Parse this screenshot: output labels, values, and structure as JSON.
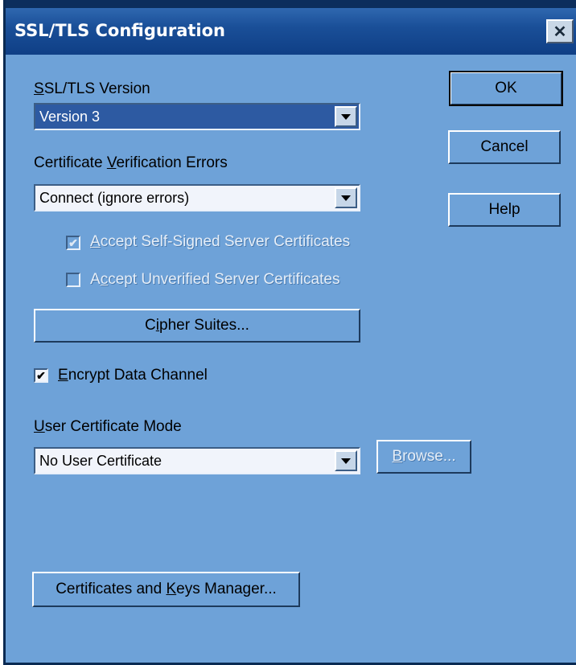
{
  "window": {
    "title": "SSL/TLS Configuration",
    "close_glyph": "✕"
  },
  "ssl_version": {
    "label_key": "S",
    "label_rest": "SL/TLS Version",
    "value": "Version 3"
  },
  "cert_errors": {
    "label_pre": "Certificate ",
    "label_key": "V",
    "label_rest": "erification Errors",
    "value": "Connect (ignore errors)"
  },
  "self_signed": {
    "checked": true,
    "label_key": "A",
    "label_rest": "ccept Self-Signed Server Certificates"
  },
  "unverified": {
    "checked": false,
    "label_pre": "A",
    "label_key": "c",
    "label_rest": "cept Unverified Server Certificates"
  },
  "cipher_button": {
    "label_pre": "C",
    "label_key": "i",
    "label_rest": "pher Suites..."
  },
  "encrypt": {
    "checked": true,
    "label_key": "E",
    "label_rest": "ncrypt Data Channel"
  },
  "user_cert": {
    "label_key": "U",
    "label_rest": "ser Certificate Mode",
    "value": "No User Certificate"
  },
  "browse_button": {
    "label_key": "B",
    "label_rest": "rowse..."
  },
  "cert_manager_button": {
    "label_pre": "Certificates and ",
    "label_key": "K",
    "label_rest": "eys Manager..."
  },
  "ok_button": {
    "label": "OK"
  },
  "cancel_button": {
    "label": "Cancel"
  },
  "help_button": {
    "label": "Help"
  },
  "colors": {
    "dialog_bg": "#6ea2d8",
    "titlebar": "#1a4f98",
    "selection": "#2d5aa2"
  }
}
